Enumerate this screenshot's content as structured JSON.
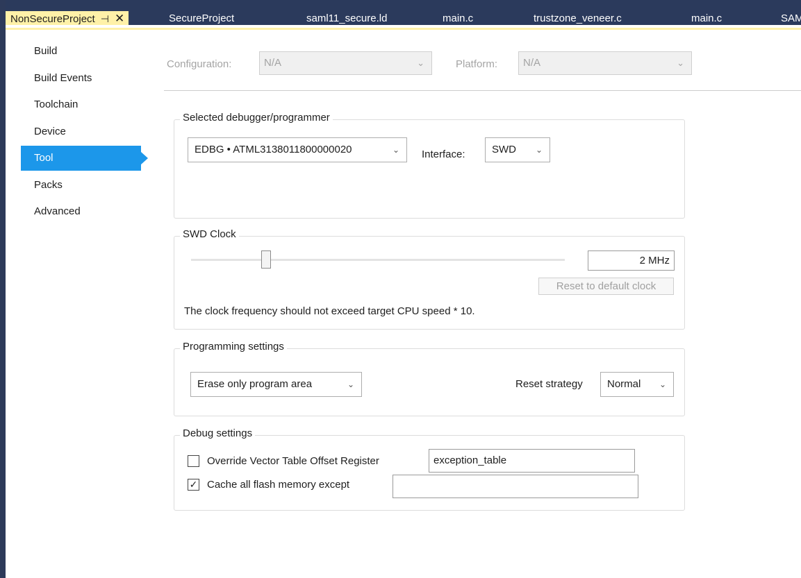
{
  "tabs": [
    {
      "label": "NonSecureProject",
      "active": true,
      "pin": "⊣",
      "close": "✕"
    },
    {
      "label": "SecureProject"
    },
    {
      "label": "saml11_secure.ld"
    },
    {
      "label": "main.c"
    },
    {
      "label": "trustzone_veneer.c"
    },
    {
      "label": "main.c"
    },
    {
      "label": "SAM"
    }
  ],
  "sidebar": {
    "items": [
      {
        "label": "Build"
      },
      {
        "label": "Build Events"
      },
      {
        "label": "Toolchain"
      },
      {
        "label": "Device"
      },
      {
        "label": "Tool",
        "selected": true
      },
      {
        "label": "Packs"
      },
      {
        "label": "Advanced"
      }
    ]
  },
  "config": {
    "configuration_label": "Configuration:",
    "configuration_value": "N/A",
    "platform_label": "Platform:",
    "platform_value": "N/A"
  },
  "debugger": {
    "title": "Selected debugger/programmer",
    "tool_value": "EDBG • ATML3138011800000020",
    "interface_label": "Interface:",
    "interface_value": "SWD"
  },
  "swd_clock": {
    "title": "SWD Clock",
    "value_text": "2 MHz",
    "slider_fraction": 0.2,
    "reset_button": "Reset to default clock",
    "note": "The clock frequency should not exceed target CPU speed * 10."
  },
  "programming": {
    "title": "Programming settings",
    "erase_value": "Erase only program area",
    "reset_strategy_label": "Reset strategy",
    "reset_strategy_value": "Normal"
  },
  "debug": {
    "title": "Debug settings",
    "override_label": "Override Vector Table Offset Register",
    "override_checked": false,
    "override_value": "exception_table",
    "cache_label": "Cache all flash memory except",
    "cache_checked": true,
    "cache_value": "",
    "check_mark": "✓"
  },
  "icons": {
    "chevron": "⌄"
  },
  "colors": {
    "accent": "#1c97ea",
    "active_tab": "#fff1a8",
    "tabbar": "#2b3a5c"
  }
}
